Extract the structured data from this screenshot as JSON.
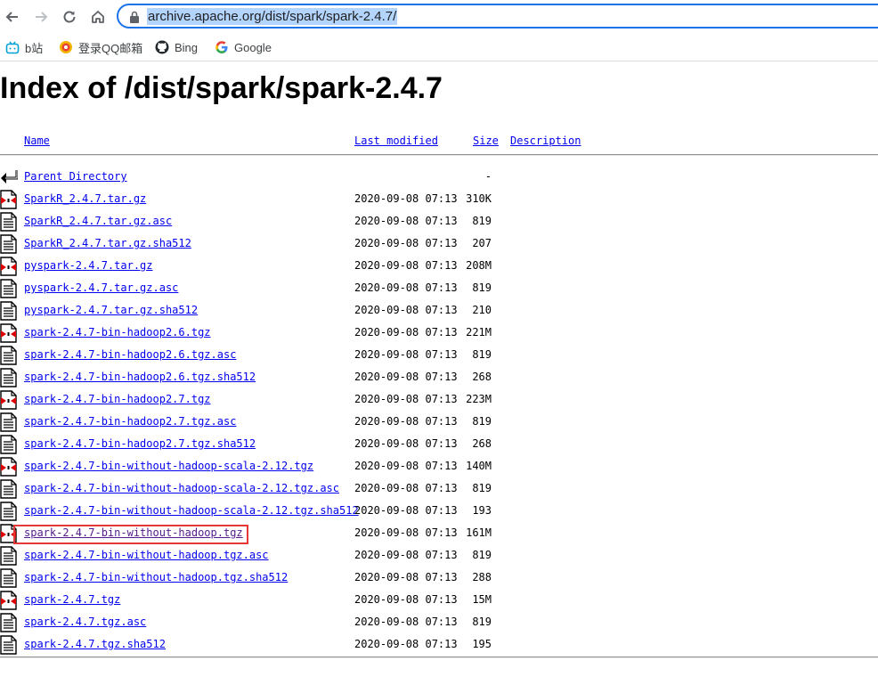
{
  "browser": {
    "url": "archive.apache.org/dist/spark/spark-2.4.7/"
  },
  "bookmarks": [
    {
      "label": "b站",
      "icon": "bilibili-icon"
    },
    {
      "label": "登录QQ邮箱",
      "icon": "qq-mail-icon"
    },
    {
      "label": "Bing",
      "icon": "github-icon"
    },
    {
      "label": "Google",
      "icon": "google-icon"
    }
  ],
  "page": {
    "title": "Index of /dist/spark/spark-2.4.7",
    "columns": {
      "name": "Name",
      "last_modified": "Last modified",
      "size": "Size",
      "description": "Description"
    },
    "parent": {
      "label": "Parent Directory",
      "size": "-"
    },
    "files": [
      {
        "name": "SparkR_2.4.7.tar.gz",
        "date": "2020-09-08 07:13",
        "size": "310K",
        "type": "archive"
      },
      {
        "name": "SparkR_2.4.7.tar.gz.asc",
        "date": "2020-09-08 07:13",
        "size": "819",
        "type": "text"
      },
      {
        "name": "SparkR_2.4.7.tar.gz.sha512",
        "date": "2020-09-08 07:13",
        "size": "207",
        "type": "text"
      },
      {
        "name": "pyspark-2.4.7.tar.gz",
        "date": "2020-09-08 07:13",
        "size": "208M",
        "type": "archive"
      },
      {
        "name": "pyspark-2.4.7.tar.gz.asc",
        "date": "2020-09-08 07:13",
        "size": "819",
        "type": "text"
      },
      {
        "name": "pyspark-2.4.7.tar.gz.sha512",
        "date": "2020-09-08 07:13",
        "size": "210",
        "type": "text"
      },
      {
        "name": "spark-2.4.7-bin-hadoop2.6.tgz",
        "date": "2020-09-08 07:13",
        "size": "221M",
        "type": "archive"
      },
      {
        "name": "spark-2.4.7-bin-hadoop2.6.tgz.asc",
        "date": "2020-09-08 07:13",
        "size": "819",
        "type": "text"
      },
      {
        "name": "spark-2.4.7-bin-hadoop2.6.tgz.sha512",
        "date": "2020-09-08 07:13",
        "size": "268",
        "type": "text"
      },
      {
        "name": "spark-2.4.7-bin-hadoop2.7.tgz",
        "date": "2020-09-08 07:13",
        "size": "223M",
        "type": "archive"
      },
      {
        "name": "spark-2.4.7-bin-hadoop2.7.tgz.asc",
        "date": "2020-09-08 07:13",
        "size": "819",
        "type": "text"
      },
      {
        "name": "spark-2.4.7-bin-hadoop2.7.tgz.sha512",
        "date": "2020-09-08 07:13",
        "size": "268",
        "type": "text"
      },
      {
        "name": "spark-2.4.7-bin-without-hadoop-scala-2.12.tgz",
        "date": "2020-09-08 07:13",
        "size": "140M",
        "type": "archive"
      },
      {
        "name": "spark-2.4.7-bin-without-hadoop-scala-2.12.tgz.asc",
        "date": "2020-09-08 07:13",
        "size": "819",
        "type": "text"
      },
      {
        "name": "spark-2.4.7-bin-without-hadoop-scala-2.12.tgz.sha512",
        "date": "2020-09-08 07:13",
        "size": "193",
        "type": "text"
      },
      {
        "name": "spark-2.4.7-bin-without-hadoop.tgz",
        "date": "2020-09-08 07:13",
        "size": "161M",
        "type": "archive",
        "highlighted": true,
        "visited": true
      },
      {
        "name": "spark-2.4.7-bin-without-hadoop.tgz.asc",
        "date": "2020-09-08 07:13",
        "size": "819",
        "type": "text"
      },
      {
        "name": "spark-2.4.7-bin-without-hadoop.tgz.sha512",
        "date": "2020-09-08 07:13",
        "size": "288",
        "type": "text"
      },
      {
        "name": "spark-2.4.7.tgz",
        "date": "2020-09-08 07:13",
        "size": "15M",
        "type": "archive"
      },
      {
        "name": "spark-2.4.7.tgz.asc",
        "date": "2020-09-08 07:13",
        "size": "819",
        "type": "text"
      },
      {
        "name": "spark-2.4.7.tgz.sha512",
        "date": "2020-09-08 07:13",
        "size": "195",
        "type": "text"
      }
    ]
  },
  "colors": {
    "link": "#0000ee",
    "visited": "#551a8b",
    "highlight_box": "#e53935",
    "omnibox_focus": "#1a73e8"
  }
}
